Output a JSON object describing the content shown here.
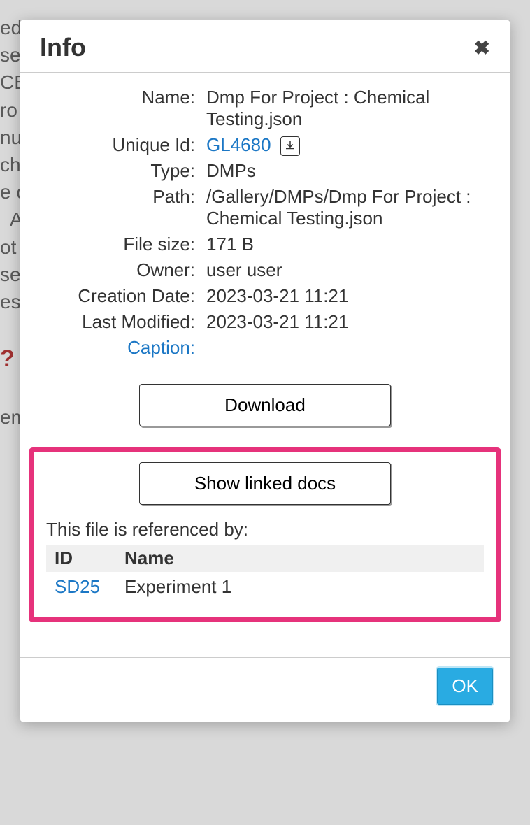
{
  "dialog": {
    "title": "Info",
    "fields": {
      "name_label": "Name:",
      "name_value": "Dmp For Project : Chemical Testing.json",
      "uid_label": "Unique Id:",
      "uid_value": "GL4680",
      "type_label": "Type:",
      "type_value": "DMPs",
      "path_label": "Path:",
      "path_value": "/Gallery/DMPs/Dmp For Project : Chemical Testing.json",
      "size_label": "File size:",
      "size_value": "171 B",
      "owner_label": "Owner:",
      "owner_value": "user user",
      "created_label": "Creation Date:",
      "created_value": "2023-03-21 11:21",
      "modified_label": "Last Modified:",
      "modified_value": "2023-03-21 11:21",
      "caption_label": "Caption:"
    },
    "buttons": {
      "download": "Download",
      "show_linked": "Show linked docs",
      "ok": "OK"
    },
    "references": {
      "heading": "This file is referenced by:",
      "columns": {
        "id": "ID",
        "name": "Name"
      },
      "rows": [
        {
          "id": "SD25",
          "name": "Experiment 1"
        }
      ]
    }
  }
}
